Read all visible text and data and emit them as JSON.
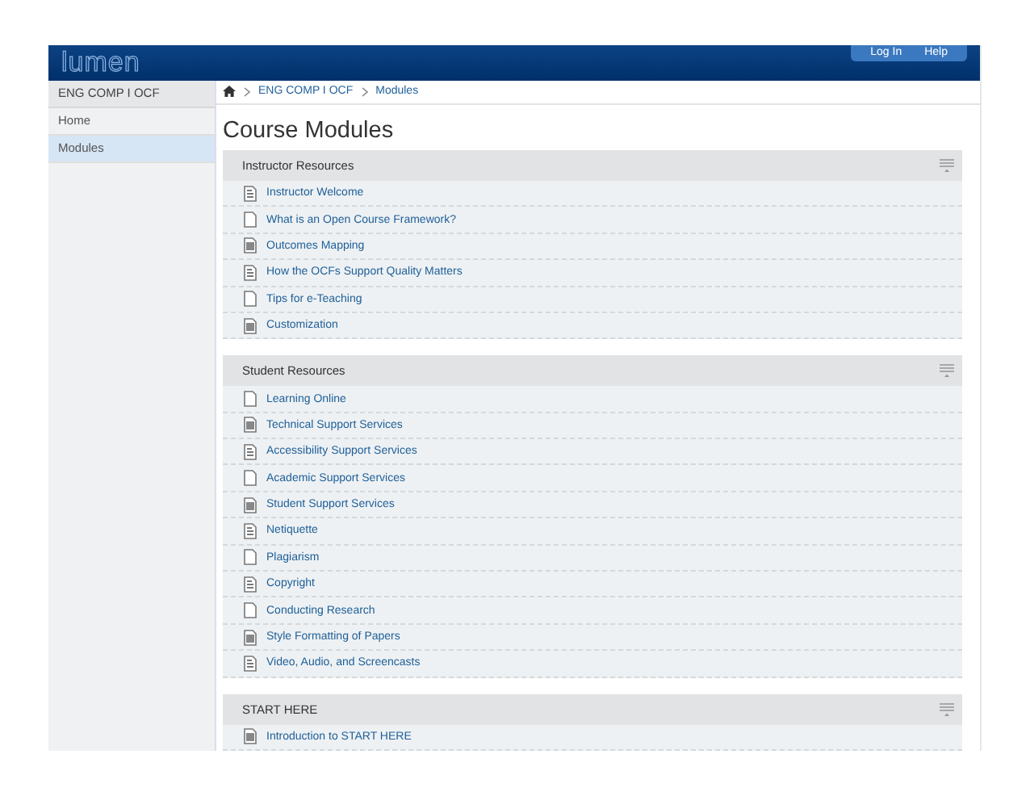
{
  "header": {
    "logo": "lumen",
    "links": [
      "Log In",
      "Help"
    ]
  },
  "sidebar": {
    "title": "ENG COMP I OCF",
    "items": [
      {
        "label": "Home",
        "selected": false
      },
      {
        "label": "Modules",
        "selected": true
      }
    ]
  },
  "breadcrumb": [
    "ENG COMP I OCF",
    "Modules"
  ],
  "page_title": "Course Modules",
  "modules": [
    {
      "title": "Instructor Resources",
      "items": [
        {
          "label": "Instructor Welcome",
          "kind": "text"
        },
        {
          "label": "What is an Open Course Framework?",
          "kind": "blank"
        },
        {
          "label": "Outcomes Mapping",
          "kind": "filled"
        },
        {
          "label": "How the OCFs Support Quality Matters",
          "kind": "text"
        },
        {
          "label": "Tips for e-Teaching",
          "kind": "blank"
        },
        {
          "label": "Customization",
          "kind": "filled"
        }
      ]
    },
    {
      "title": "Student Resources",
      "items": [
        {
          "label": "Learning Online",
          "kind": "blank"
        },
        {
          "label": "Technical Support Services",
          "kind": "filled"
        },
        {
          "label": "Accessibility Support Services",
          "kind": "text"
        },
        {
          "label": "Academic Support Services",
          "kind": "blank"
        },
        {
          "label": "Student Support Services",
          "kind": "filled"
        },
        {
          "label": "Netiquette",
          "kind": "text"
        },
        {
          "label": "Plagiarism",
          "kind": "blank"
        },
        {
          "label": "Copyright",
          "kind": "text"
        },
        {
          "label": "Conducting Research",
          "kind": "blank"
        },
        {
          "label": "Style Formatting of Papers",
          "kind": "filled"
        },
        {
          "label": "Video, Audio, and Screencasts",
          "kind": "text"
        }
      ]
    },
    {
      "title": "START HERE",
      "items": [
        {
          "label": "Introduction to START HERE",
          "kind": "filled"
        }
      ]
    }
  ]
}
